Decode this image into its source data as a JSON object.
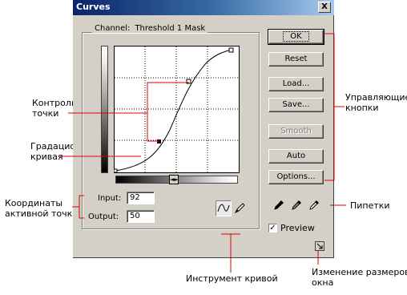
{
  "dialog": {
    "title": "Curves",
    "close_label": "X",
    "channel_label": "Channel:",
    "channel_value": "Threshold 1 Mask",
    "input_label": "Input:",
    "input_value": "92",
    "output_label": "Output:",
    "output_value": "50",
    "buttons": {
      "ok": "OK",
      "reset": "Reset",
      "load": "Load...",
      "save": "Save...",
      "smooth": "Smooth",
      "auto": "Auto",
      "options": "Options..."
    },
    "preview_label": "Preview",
    "preview_checked": true
  },
  "annotations": {
    "control_points": [
      "Контрольные",
      "точки"
    ],
    "gradation_curve": [
      "Градационная",
      "кривая"
    ],
    "coordinates": [
      "Координаты",
      "активной точки"
    ],
    "control_buttons": [
      "Управляющие",
      "кнопки"
    ],
    "pipettes": "Пипетки",
    "curve_tool": "Инструмент кривой",
    "resize": [
      "Изменение размеров",
      "окна"
    ]
  },
  "icons": {
    "curve_tool": "curve-tool-icon",
    "pencil_tool": "pencil-tool-icon",
    "eyedroppers": [
      "black-eyedropper-icon",
      "gray-eyedropper-icon",
      "white-eyedropper-icon"
    ],
    "resize": "resize-icon"
  }
}
